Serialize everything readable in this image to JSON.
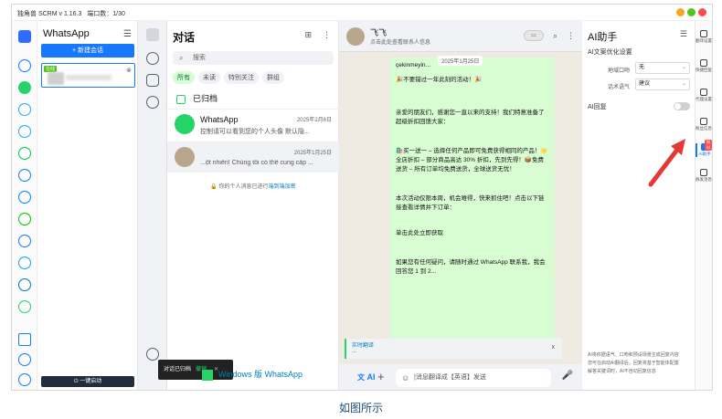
{
  "app": {
    "title": "独角兽 SCRM v 1.16.3",
    "port_count": "端口数：1/30"
  },
  "sessions": {
    "title": "WhatsApp",
    "new_button": "+ 新建会话",
    "online_badge": "在线",
    "one_click_start": "一键启动"
  },
  "chat_list": {
    "title": "对话",
    "search_placeholder": "搜索",
    "filters": [
      "所有",
      "未读",
      "特别关注",
      "群组"
    ],
    "archived": "已归档",
    "rows": [
      {
        "name": "WhatsApp",
        "date": "2025年2月6日",
        "message": "控制请可以看到您的个人头像 默认隐..."
      },
      {
        "name": "",
        "date": "2025年1月25日",
        "message": "...ột nhiên! Chúng tôi có thể cung cấp ..."
      }
    ],
    "encryption_note": "你的个人消息已进行",
    "encryption_link": "端到端加密",
    "windows_promo": "Windows 版 WhatsApp"
  },
  "toast": {
    "text": "对话已归档",
    "undo": "撤销"
  },
  "chat": {
    "contact_name": "飞飞",
    "contact_sub": "点击此处查看联系人信息",
    "date_pill": "2025年1月25日",
    "messages": [
      "çekinmeyin...",
      "🎉不要错过一年此刻的活动！🎉",
      "亲爱的朋友们，感谢您一直以来的支持！我们特意准备了超级折扣回馈大家：",
      "🛍️买一送一 – 选择任何产品即可免费获得相同的产品！🌟全店折扣 – 部分商品高达 30% 折扣，先到先得！📦免费送货 – 所有订单均免费送货，全球送货无忧！",
      "本次活动仅限本周，机会难得，快来抓住吧！点击以下链接查看详情并下订单：",
      "单击此处立即获取",
      "如果您有任何疑问，请随时通过 WhatsApp 联系我，我会回答您 1 到 2..."
    ],
    "translate_label": "实时翻译",
    "translate_text": "...",
    "ai_tag": "AI",
    "input_placeholder": "|消息翻译成【英语】发送"
  },
  "ai_panel": {
    "title": "AI助手",
    "section": "AI文案优化设置",
    "region_label": "地域口吻",
    "region_value": "无",
    "tone_label": "话术语气",
    "tone_value": "建议",
    "reply_label": "AI回复",
    "notes": [
      "AI将依据语气、口吻和预设场景生成回复内容",
      "您可在启动AI翻译后，回复将基于智能体配置",
      "解答关键词时，AI不自动回复信息"
    ]
  },
  "right_rail": [
    {
      "label": "翻译设置"
    },
    {
      "label": "快捷回复"
    },
    {
      "label": "代理设置"
    },
    {
      "label": "粉丝信息"
    },
    {
      "label": "AI助手",
      "badge": "限时"
    },
    {
      "label": "群发消息"
    }
  ],
  "caption": "如图所示",
  "colors": {
    "accent": "#1677ff",
    "whatsapp_green": "#25d366",
    "bubble": "#d9fdd3"
  }
}
